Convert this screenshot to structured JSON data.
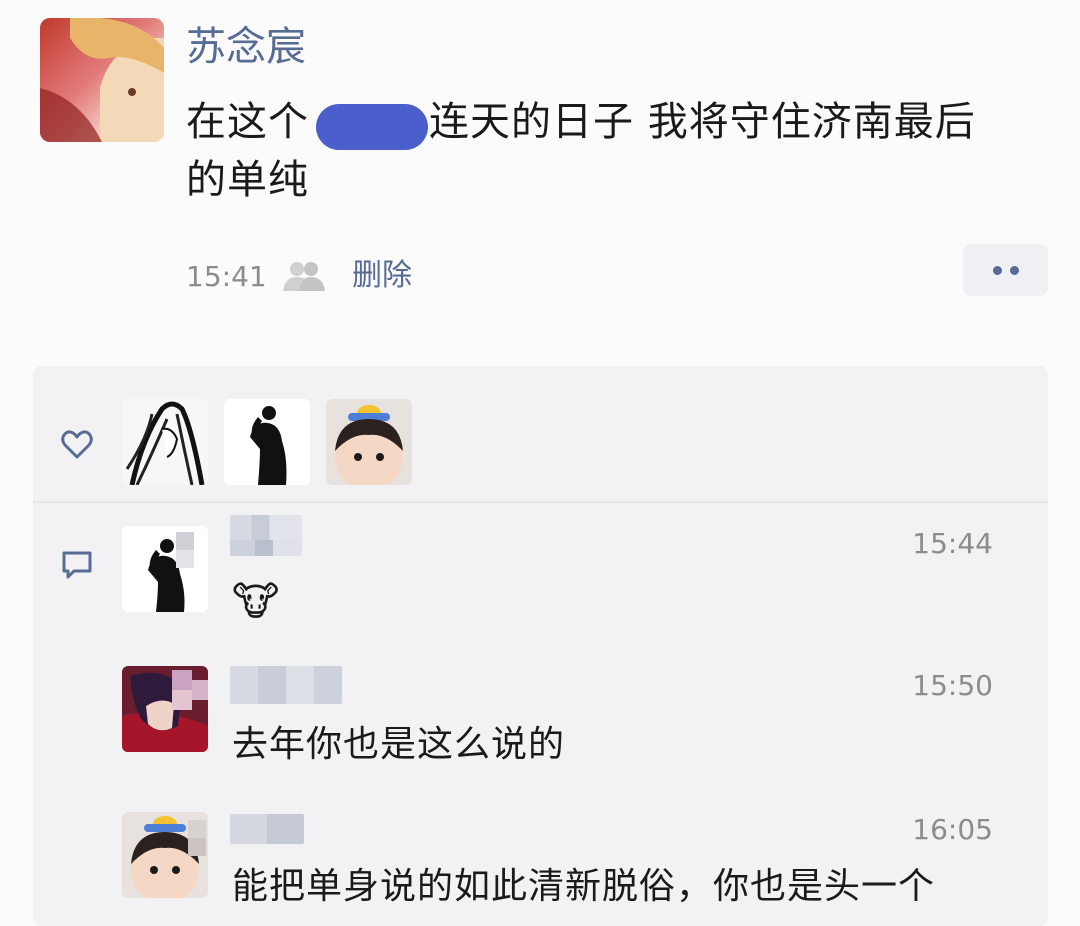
{
  "post": {
    "author": "苏念宸",
    "text_line1_a": "在这个",
    "text_line1_b": "连天的日子 我将守住济南最后",
    "text_line2": "的单纯",
    "time": "15:41",
    "delete_label": "删除"
  },
  "likes": {
    "icon": "heart-icon",
    "avatars": [
      "avatar-ink-drawing",
      "avatar-silhouette",
      "avatar-baby-duck"
    ]
  },
  "comments": [
    {
      "time": "15:44",
      "text": "🐮"
    },
    {
      "time": "15:50",
      "text": "去年你也是这么说的"
    },
    {
      "time": "16:05",
      "text": "能把单身说的如此清新脱俗，你也是头一个"
    }
  ],
  "colors": {
    "link": "#576b95",
    "censor": "#4a5fcc",
    "panel": "#f2f2f4"
  }
}
